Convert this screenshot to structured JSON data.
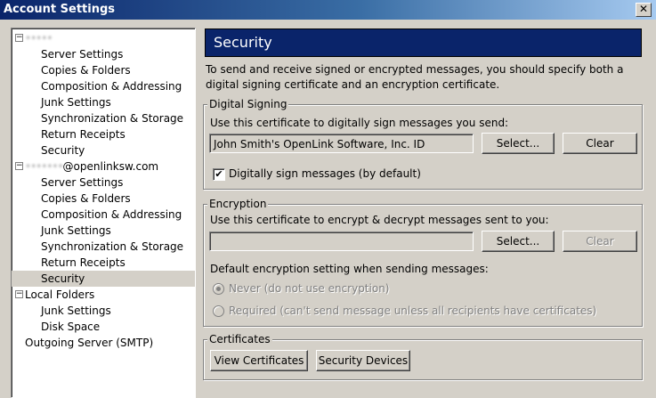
{
  "window": {
    "title": "Account Settings",
    "close_glyph": "✕"
  },
  "tree": {
    "account1_label": "•••••",
    "account1_items": [
      "Server Settings",
      "Copies & Folders",
      "Composition & Addressing",
      "Junk Settings",
      "Synchronization & Storage",
      "Return Receipts",
      "Security"
    ],
    "account2_label_hidden": "•••••••",
    "account2_label_visible": "@openlinksw.com",
    "account2_items": [
      "Server Settings",
      "Copies & Folders",
      "Composition & Addressing",
      "Junk Settings",
      "Synchronization & Storage",
      "Return Receipts",
      "Security"
    ],
    "local_folders_label": "Local Folders",
    "local_items": [
      "Junk Settings",
      "Disk Space"
    ],
    "outgoing_label": "Outgoing Server (SMTP)",
    "expander_glyph": "−"
  },
  "panel": {
    "title": "Security",
    "intro": "To send and receive signed or encrypted messages, you should specify both a digital signing certificate and an encryption certificate."
  },
  "digital_signing": {
    "legend": "Digital Signing",
    "instruction": "Use this certificate to digitally sign messages you send:",
    "certificate_value": "John Smith's OpenLink Software, Inc. ID",
    "select_label": "Select...",
    "clear_label": "Clear",
    "checkbox_label": "Digitally sign messages (by default)",
    "checkbox_checked": true,
    "check_glyph": "✔"
  },
  "encryption": {
    "legend": "Encryption",
    "instruction": "Use this certificate to encrypt & decrypt messages sent to you:",
    "certificate_value": "",
    "select_label": "Select...",
    "clear_label": "Clear",
    "default_setting_label": "Default encryption setting when sending messages:",
    "never_label": "Never (do not use encryption)",
    "required_label": "Required (can't send message unless all recipients have certificates)"
  },
  "certificates": {
    "legend": "Certificates",
    "view_label": "View Certificates",
    "devices_label": "Security Devices"
  }
}
